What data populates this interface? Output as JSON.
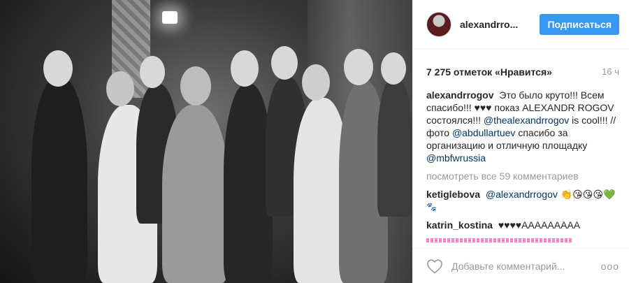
{
  "photo": {
    "alt": ""
  },
  "header": {
    "username": "alexandrro...",
    "follow_label": "Подписаться"
  },
  "post": {
    "likes": "7 275 отметок «Нравится»",
    "time": "16 ч"
  },
  "caption": {
    "user": "alexandrrogov",
    "text_1": "Это было круто!!! Всем спасибо!!! ♥♥♥ показ ALEXANDR ROGOV состоялся!!! ",
    "mention_1": "@thealexandrrogov",
    "text_2": " is cool!!! //фото ",
    "mention_2": "@abdullartuev",
    "text_3": " спасибо за организацию и отличную площадку ",
    "mention_3": "@mbfwrussia"
  },
  "more_comments": "посмотреть все 59 комментариев",
  "comments": [
    {
      "user": "ketiglebova",
      "mention": "@alexandrrogov",
      "text": "👏😘😘😘💚",
      "extra": "🐾"
    },
    {
      "user": "katrin_kostina",
      "text": "♥♥♥♥ААААААААА"
    }
  ],
  "add_comment": {
    "placeholder": "Добавьте комментарий...",
    "more": "ooo"
  },
  "colors": {
    "accent": "#3897f0",
    "link": "#003569",
    "muted": "#999999"
  }
}
